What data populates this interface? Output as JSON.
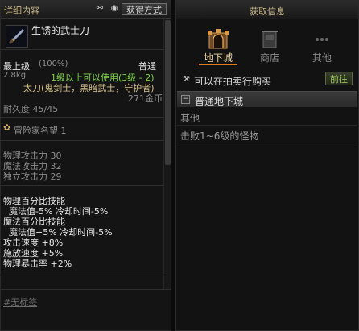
{
  "left_panel": {
    "title": "详细内容",
    "header_icons": [
      "link-icon",
      "eye-icon"
    ],
    "get_button": "获得方式",
    "item": {
      "name": "生锈的武士刀",
      "grade": "最上级",
      "grade_percent": "(100%)",
      "rarity": "普通",
      "weight": "2.8kg",
      "level_req": "1级以上可以使用(3级 - 2)",
      "classes": "太刀(鬼剑士，黑暗武士，守护者)",
      "price": "271金币",
      "durability": "耐久度 45/45",
      "renown": "冒险家名望 1",
      "stats": [
        "物理攻击力 30",
        "魔法攻击力 32",
        "独立攻击力 29"
      ],
      "skills": [
        "物理百分比技能",
        "  魔法值-5% 冷却时间-5%",
        "魔法百分比技能",
        "  魔法值+5% 冷却时间-5%",
        "攻击速度 +8%",
        "施放速度 +5%",
        "物理暴击率 +2%"
      ],
      "tag": "#无标签"
    }
  },
  "right_panel": {
    "title": "获取信息",
    "tabs": [
      {
        "label": "地下城",
        "icon": "dungeon-gate-icon",
        "active": true
      },
      {
        "label": "商店",
        "icon": "shop-icon",
        "active": false
      },
      {
        "label": "其他",
        "icon": "more-dots-icon",
        "active": false
      }
    ],
    "auction_text": "可以在拍卖行购买",
    "goto_button": "前往",
    "dungeon_section": "普通地下城",
    "sources": [
      "其他",
      "击败1~6级的怪物"
    ]
  },
  "colors": {
    "accent_orange": "#e07a1a",
    "green_text": "#7fd24a",
    "gold_text": "#d6c08a"
  }
}
